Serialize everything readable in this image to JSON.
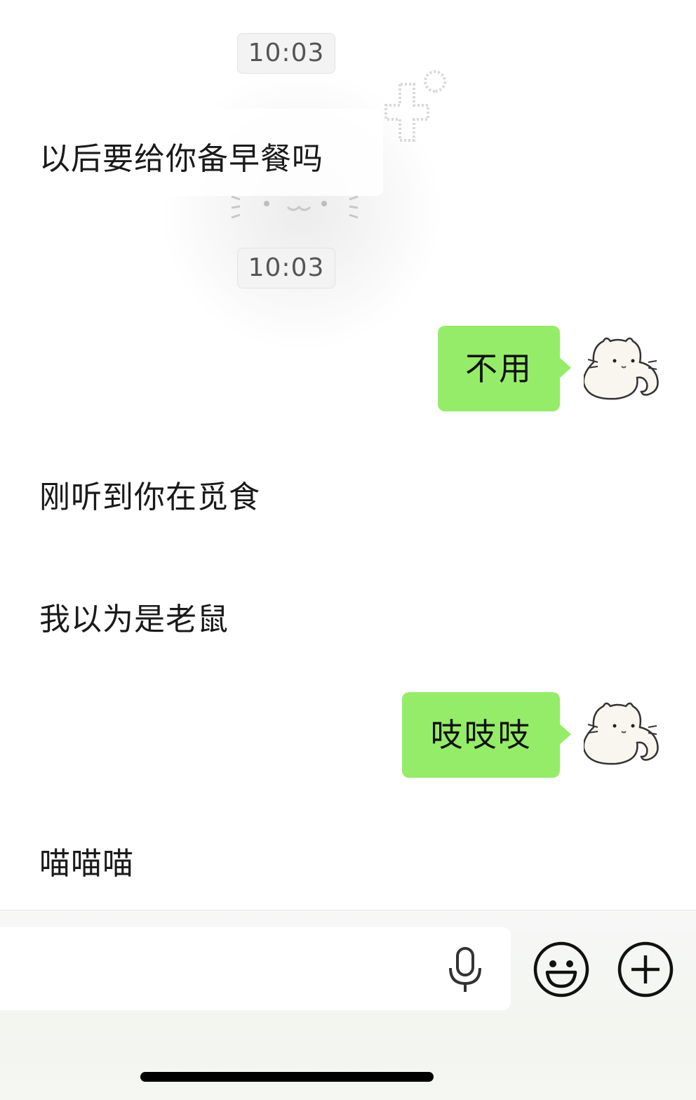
{
  "chat": {
    "timestamps": [
      "10:03",
      "10:03"
    ],
    "messages": [
      {
        "side": "incoming",
        "text": "以后要给你备早餐吗"
      },
      {
        "side": "outgoing",
        "text": "不用"
      },
      {
        "side": "incoming",
        "text": "刚听到你在觅食"
      },
      {
        "side": "incoming",
        "text": "我以为是老鼠"
      },
      {
        "side": "outgoing",
        "text": "吱吱吱"
      },
      {
        "side": "incoming",
        "text": "喵喵喵"
      }
    ]
  },
  "colors": {
    "outgoing_bubble": "#95ec69",
    "timestamp_bg": "#f3f3f3",
    "text": "#1a1a1a"
  },
  "input_bar": {
    "text_value": "",
    "icons": [
      "microphone-icon",
      "smiley-face-icon",
      "plus-icon"
    ]
  },
  "avatar": {
    "icon": "white-cat-icon"
  }
}
